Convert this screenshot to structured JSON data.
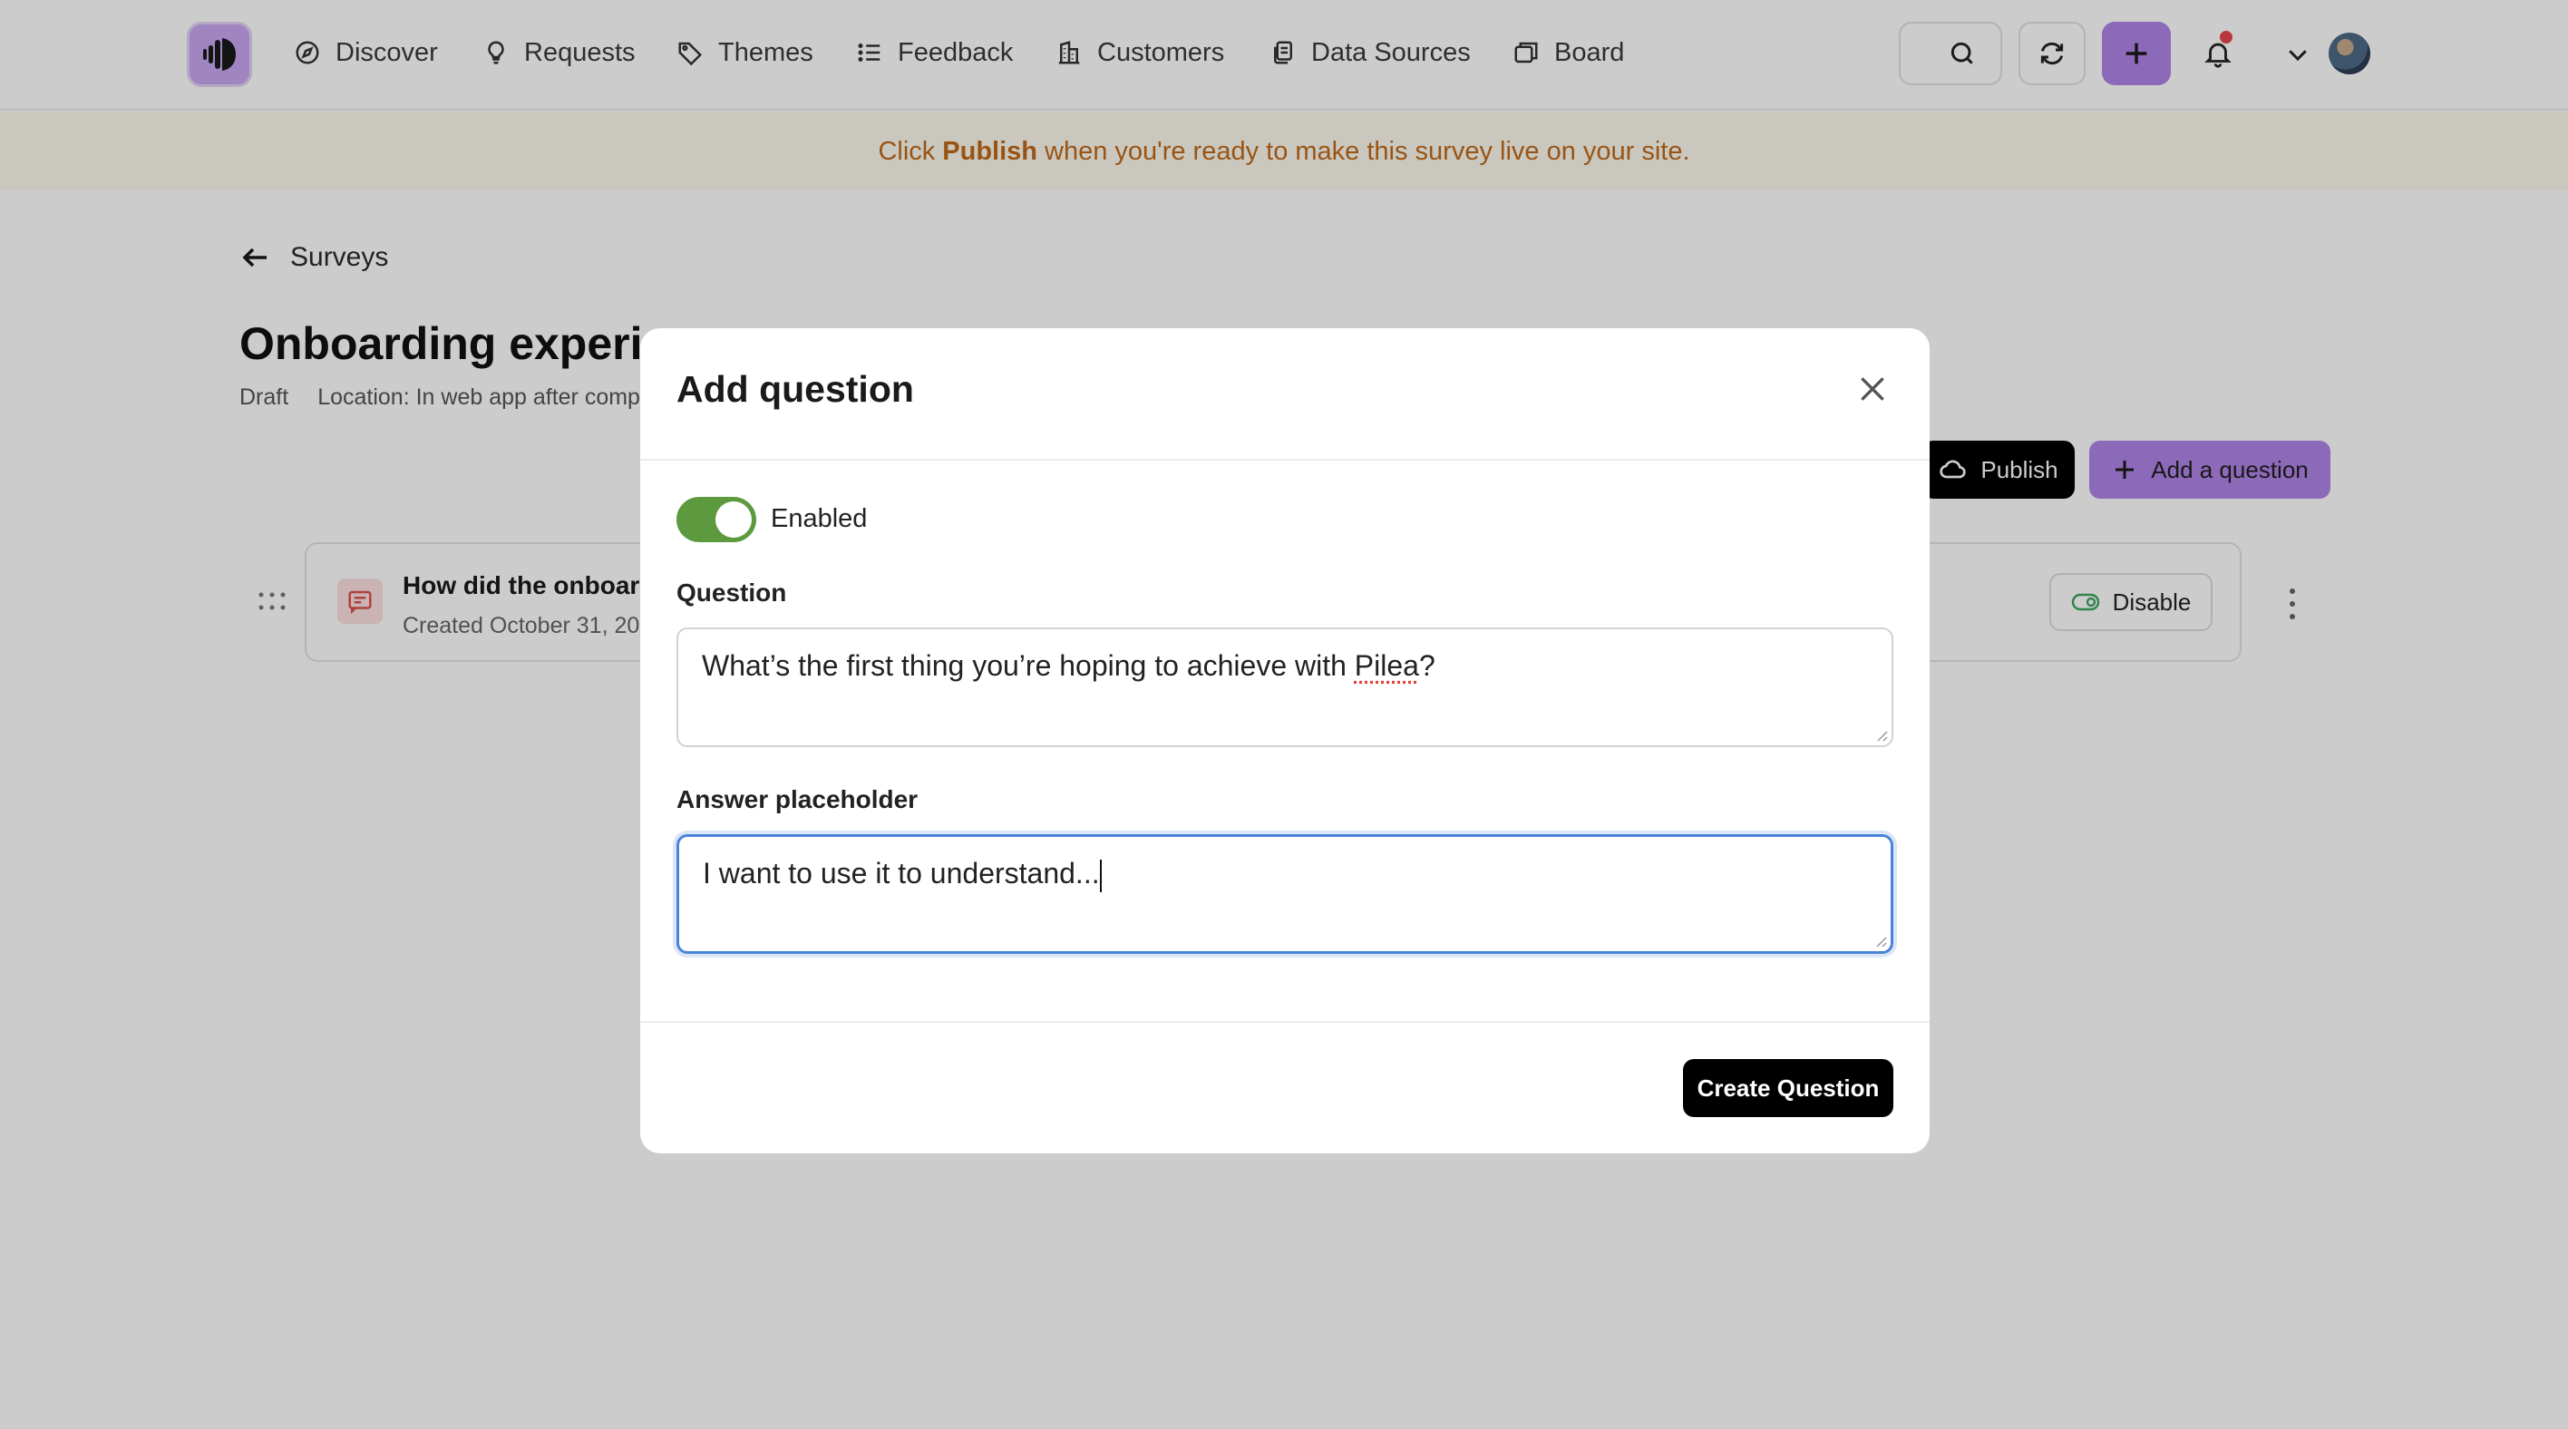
{
  "nav": {
    "items": [
      {
        "label": "Discover",
        "icon": "compass-icon"
      },
      {
        "label": "Requests",
        "icon": "lightbulb-icon"
      },
      {
        "label": "Themes",
        "icon": "tag-icon"
      },
      {
        "label": "Feedback",
        "icon": "list-icon"
      },
      {
        "label": "Customers",
        "icon": "building-icon"
      },
      {
        "label": "Data Sources",
        "icon": "documents-icon"
      },
      {
        "label": "Board",
        "icon": "board-icon"
      }
    ]
  },
  "banner": {
    "prefix": "Click",
    "emphasis": "Publish",
    "suffix": "when you're ready to make this survey live on your site."
  },
  "page": {
    "back_label": "Surveys",
    "title": "Onboarding experien",
    "status": "Draft",
    "location": "Location: In web app after comp",
    "publish_label": "Publish",
    "add_question_label": "Add a question",
    "question_card": {
      "title": "How did the onboard",
      "created": "Created October 31, 20",
      "disable_label": "Disable"
    }
  },
  "modal": {
    "title": "Add question",
    "toggle_label": "Enabled",
    "toggle_on": true,
    "question_label": "Question",
    "question_value_pre": "What’s the first thing you’re hoping to achieve with ",
    "question_value_mark": "Pilea",
    "question_value_post": "?",
    "answer_label": "Answer placeholder",
    "answer_value": "I want to use it to understand...",
    "create_label": "Create Question"
  },
  "colors": {
    "accent": "#b084e8",
    "banner_text": "#c06a1b",
    "toggle_on": "#5d9a3f",
    "focus_ring": "#4a84d6"
  }
}
